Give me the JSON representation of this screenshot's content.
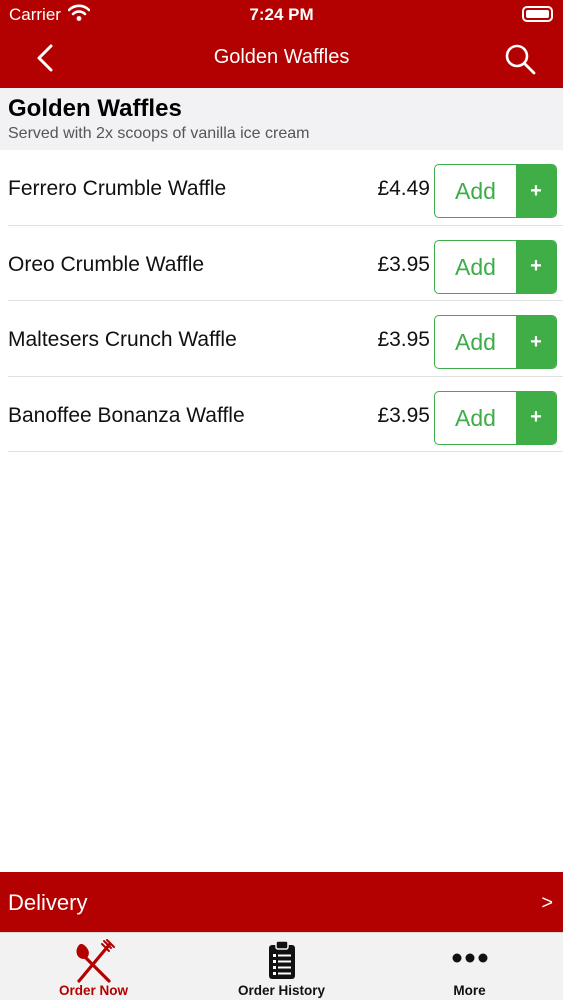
{
  "status_bar": {
    "carrier": "Carrier",
    "time": "7:24 PM"
  },
  "nav": {
    "title": "Golden Waffles",
    "back_icon": "chevron-left-icon",
    "search_icon": "search-icon"
  },
  "section": {
    "title": "Golden Waffles",
    "subtitle": "Served with 2x scoops of vanilla ice cream"
  },
  "items": [
    {
      "name": "Ferrero Crumble Waffle",
      "price": "£4.49",
      "button_label": "Add",
      "plus": "+"
    },
    {
      "name": "Oreo Crumble Waffle",
      "price": "£3.95",
      "button_label": "Add",
      "plus": "+"
    },
    {
      "name": "Maltesers Crunch Waffle",
      "price": "£3.95",
      "button_label": "Add",
      "plus": "+"
    },
    {
      "name": "Banoffee Bonanza Waffle",
      "price": "£3.95",
      "button_label": "Add",
      "plus": "+"
    }
  ],
  "delivery": {
    "label": "Delivery",
    "chevron": ">"
  },
  "tabs": [
    {
      "label": "Order Now",
      "icon": "fork-knife-icon",
      "active": true
    },
    {
      "label": "Order History",
      "icon": "clipboard-list-icon",
      "active": false
    },
    {
      "label": "More",
      "icon": "more-dots-icon",
      "active": false
    }
  ],
  "colors": {
    "brand_red": "#b30000",
    "accent_green": "#3fae47"
  }
}
